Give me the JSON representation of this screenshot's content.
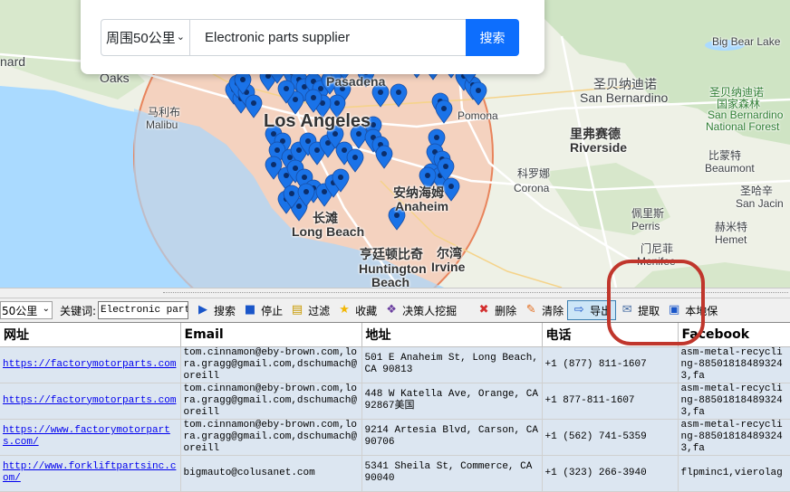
{
  "map": {
    "labels": [
      {
        "text": "Oaks",
        "cls": "city"
      },
      {
        "text": "nard",
        "cls": "city"
      },
      {
        "text": "马利布",
        "cls": "city"
      },
      {
        "text": "Malibu",
        "cls": "city"
      },
      {
        "text": "Pasadena",
        "cls": "city"
      },
      {
        "text": "Los Angeles",
        "cls": "big"
      },
      {
        "text": "Pomona",
        "cls": "city"
      },
      {
        "text": "圣贝纳迪诺",
        "cls": "city"
      },
      {
        "text": "San Bernardino",
        "cls": "city"
      },
      {
        "text": "Big Bear Lake",
        "cls": "city"
      },
      {
        "text": "圣贝纳迪诺",
        "cls": "park"
      },
      {
        "text": "国家森林",
        "cls": "park"
      },
      {
        "text": "San Bernardino",
        "cls": "park"
      },
      {
        "text": "National Forest",
        "cls": "park"
      },
      {
        "text": "里弗赛德",
        "cls": "mid"
      },
      {
        "text": "Riverside",
        "cls": "mid"
      },
      {
        "text": "科罗娜",
        "cls": "city"
      },
      {
        "text": "Corona",
        "cls": "city"
      },
      {
        "text": "安纳海姆",
        "cls": "mid"
      },
      {
        "text": "Anaheim",
        "cls": "mid"
      },
      {
        "text": "长滩",
        "cls": "mid"
      },
      {
        "text": "Long Beach",
        "cls": "mid"
      },
      {
        "text": "亨廷顿比奇",
        "cls": "mid"
      },
      {
        "text": "Huntington",
        "cls": "mid"
      },
      {
        "text": "Beach",
        "cls": "mid"
      },
      {
        "text": "尔湾",
        "cls": "mid"
      },
      {
        "text": "Irvine",
        "cls": "mid"
      },
      {
        "text": "佩里斯",
        "cls": "city"
      },
      {
        "text": "Perris",
        "cls": "city"
      },
      {
        "text": "门尼菲",
        "cls": "city"
      },
      {
        "text": "Menifee",
        "cls": "city"
      },
      {
        "text": "比蒙特",
        "cls": "city"
      },
      {
        "text": "Beaumont",
        "cls": "city"
      },
      {
        "text": "圣哈辛",
        "cls": "city"
      },
      {
        "text": "San Jacin",
        "cls": "city"
      },
      {
        "text": "赫米特",
        "cls": "city"
      },
      {
        "text": "Hemet",
        "cls": "city"
      }
    ]
  },
  "search": {
    "radius": "周围50公里",
    "keyword": "Electronic parts supplier",
    "button": "搜索"
  },
  "toolbar": {
    "radius": "50公里",
    "keyword_label": "关键词:",
    "keyword": "Electronic parts supplier",
    "search": "搜索",
    "stop": "停止",
    "filter": "过滤",
    "favorite": "收藏",
    "decision": "决策人挖掘",
    "delete": "删除",
    "clear": "清除",
    "export": "导出",
    "extract": "提取",
    "save_local": "本地保"
  },
  "table": {
    "headers": [
      "网址",
      "Email",
      "地址",
      "电话",
      "Facebook"
    ],
    "rows": [
      {
        "url": "https://factorymotorparts.com",
        "email": "tom.cinnamon@eby-brown.com,lora.gragg@gmail.com,dschumach@oreill",
        "address": "501 E Anaheim St, Long Beach, CA 90813",
        "phone": "+1 (877) 811-1607",
        "facebook": "asm-metal-recycling-885018184893243,fa"
      },
      {
        "url": "https://factorymotorparts.com",
        "email": "tom.cinnamon@eby-brown.com,lora.gragg@gmail.com,dschumach@oreill",
        "address": "448 W Katella Ave, Orange, CA 92867美国",
        "phone": "+1 877-811-1607",
        "facebook": "asm-metal-recycling-885018184893243,fa"
      },
      {
        "url": "https://www.factorymotorparts.com/",
        "email": "tom.cinnamon@eby-brown.com,lora.gragg@gmail.com,dschumach@oreill",
        "address": "9214 Artesia Blvd, Carson, CA 90706",
        "phone": "+1 (562) 741-5359",
        "facebook": "asm-metal-recycling-885018184893243,fa"
      },
      {
        "url": "http://www.forkliftpartsinc.com/",
        "email": "bigmauto@colusanet.com",
        "address": "5341 Sheila St, Commerce, CA 90040",
        "phone": "+1 (323) 266-3940",
        "facebook": "flpminc1,vierolag"
      }
    ]
  },
  "colors": {
    "pin": "#1a73e8",
    "radius_fill": "#f6c7b2",
    "radius_stroke": "#e8845c",
    "ocean": "#aadaff",
    "highlight": "#c0362c",
    "primary_button": "#0d6efd",
    "row_bg": "#dce6f1"
  }
}
